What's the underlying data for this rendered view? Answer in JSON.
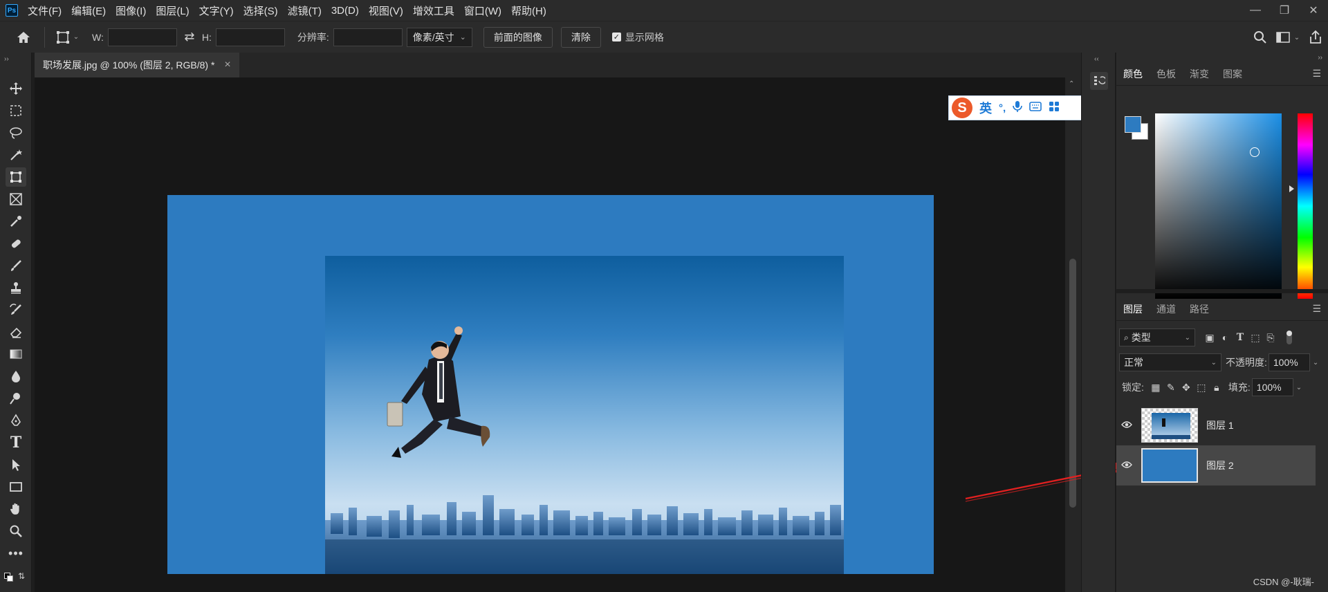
{
  "app": {
    "logo_text": "Ps"
  },
  "menu": [
    "文件(F)",
    "编辑(E)",
    "图像(I)",
    "图层(L)",
    "文字(Y)",
    "选择(S)",
    "滤镜(T)",
    "3D(D)",
    "视图(V)",
    "增效工具",
    "窗口(W)",
    "帮助(H)"
  ],
  "window_controls": {
    "minimize": "—",
    "restore": "❐",
    "close": "✕"
  },
  "options": {
    "w_label": "W:",
    "w_value": "",
    "h_label": "H:",
    "h_value": "",
    "resolution_label": "分辨率:",
    "resolution_value": "",
    "unit_select": "像素/英寸",
    "front_image_button": "前面的图像",
    "clear_button": "清除",
    "show_grid_label": "显示网格",
    "show_grid_checked": true
  },
  "document": {
    "tab_title": "职场发展.jpg @ 100% (图层 2, RGB/8) *",
    "close": "×",
    "canvas_color": "#2d7bc0"
  },
  "ime": {
    "logo": "S",
    "lang": "英",
    "punct": "°,",
    "icons": [
      "microphone-icon",
      "keyboard-icon",
      "apps-icon"
    ]
  },
  "color_panel": {
    "tabs": [
      "颜色",
      "色板",
      "渐变",
      "图案"
    ],
    "active_tab": "颜色",
    "foreground": "#2d7bc0",
    "background": "#ffffff"
  },
  "layers_panel": {
    "tabs": [
      "图层",
      "通道",
      "路径"
    ],
    "active_tab": "图层",
    "filter_select": "类型",
    "blend_mode": "正常",
    "opacity_label": "不透明度:",
    "opacity_value": "100%",
    "lock_label": "锁定:",
    "fill_label": "填充:",
    "fill_value": "100%",
    "layers": [
      {
        "name": "图层 1",
        "visible": true,
        "selected": false
      },
      {
        "name": "图层 2",
        "visible": true,
        "selected": true
      }
    ]
  },
  "watermark": "CSDN @-耿瑞-"
}
